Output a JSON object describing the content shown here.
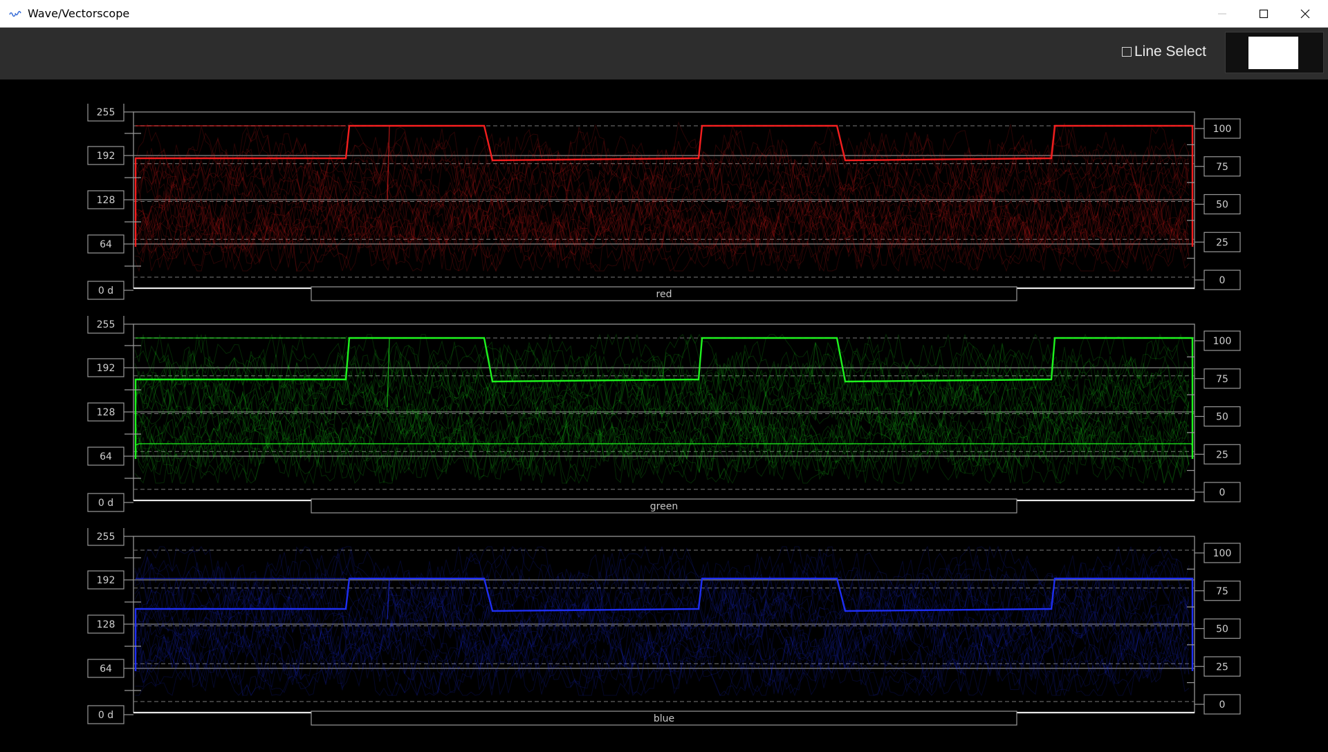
{
  "window": {
    "title": "Wave/Vectorscope",
    "icon": "waveform-app-icon",
    "controls": [
      "minimize-icon",
      "maximize-icon",
      "close-icon"
    ]
  },
  "toolbar": {
    "line_select": {
      "label": "Line Select",
      "checked": false
    },
    "color_swatch": "#ffffff"
  },
  "scopes": [
    {
      "channel": "red",
      "color": "#ff2020",
      "left_scale": [
        "255",
        "192",
        "128",
        "64",
        "0 d"
      ],
      "right_scale": [
        "100",
        "75",
        "50",
        "25",
        "0"
      ]
    },
    {
      "channel": "green",
      "color": "#20ff20",
      "left_scale": [
        "255",
        "192",
        "128",
        "64",
        "0 d"
      ],
      "right_scale": [
        "100",
        "75",
        "50",
        "25",
        "0"
      ]
    },
    {
      "channel": "blue",
      "color": "#2030ff",
      "left_scale": [
        "255",
        "192",
        "128",
        "64",
        "0 d"
      ],
      "right_scale": [
        "100",
        "75",
        "50",
        "25",
        "0"
      ]
    }
  ]
}
